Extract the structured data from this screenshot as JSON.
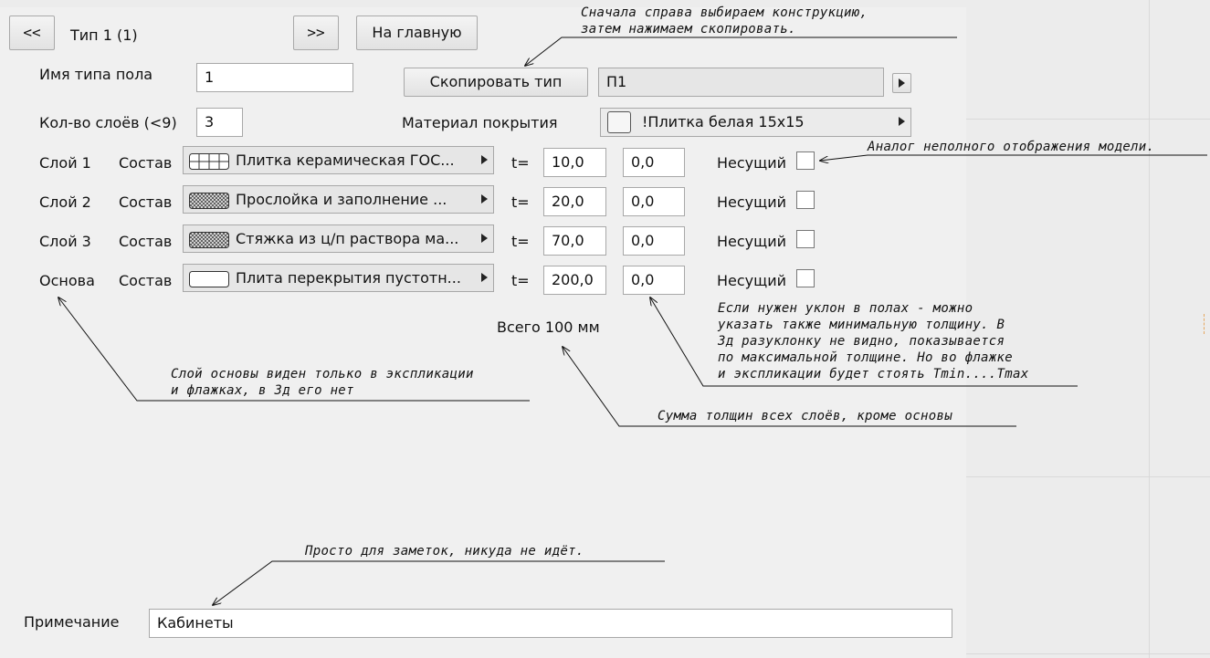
{
  "header": {
    "prev_label": "<<",
    "title": "Тип 1 (1)",
    "next_label": ">>",
    "home_label": "На главную"
  },
  "form": {
    "type_name_label": "Имя типа пола",
    "type_name_value": "1",
    "layer_count_label": "Кол-во слоёв (<9)",
    "layer_count_value": "3",
    "copy_button_label": "Скопировать тип",
    "copy_source_value": "П1",
    "covering_label": "Материал покрытия",
    "covering_value": "!Плитка белая 15х15"
  },
  "layers": [
    {
      "label": "Слой 1",
      "composition_label": "Состав",
      "material": "Плитка керамическая ГОС...",
      "pattern": "tile",
      "t_label": "t=",
      "thickness": "10,0",
      "min_thickness": "0,0",
      "bearing_label": "Несущий",
      "bearing": false
    },
    {
      "label": "Слой 2",
      "composition_label": "Состав",
      "material": "Прослойка и заполнение ...",
      "pattern": "hatch",
      "t_label": "t=",
      "thickness": "20,0",
      "min_thickness": "0,0",
      "bearing_label": "Несущий",
      "bearing": false
    },
    {
      "label": "Слой 3",
      "composition_label": "Состав",
      "material": "Стяжка из ц/п раствора ма...",
      "pattern": "hatch",
      "t_label": "t=",
      "thickness": "70,0",
      "min_thickness": "0,0",
      "bearing_label": "Несущий",
      "bearing": false
    },
    {
      "label": "Основа",
      "composition_label": "Состав",
      "material": "Плита перекрытия пустотн...",
      "pattern": "blank",
      "t_label": "t=",
      "thickness": "200,0",
      "min_thickness": "0,0",
      "bearing_label": "Несущий",
      "bearing": false
    }
  ],
  "total": "Всего 100 мм",
  "notes_field": {
    "label": "Примечание",
    "value": "Кабинеты"
  },
  "annotations": {
    "copy_hint": [
      "Сначала справа выбираем конструкцию,",
      "затем нажимаем скопировать."
    ],
    "bearing_hint": "Аналог неполного отображения модели.",
    "slope_hint": [
      "Если нужен уклон в полах - можно",
      "указать также минимальную толщину. В",
      "3д разуклонку не видно, показывается",
      "по максимальной толщине. Но во флажке",
      "и экспликации будет стоять Tmin....Tmax"
    ],
    "base_hint": [
      "Слой основы виден только в экспликации",
      "и флажках, в 3д его нет"
    ],
    "sum_hint": "Сумма толщин всех слоёв, кроме основы",
    "notes_hint": "Просто для заметок, никуда не идёт."
  }
}
